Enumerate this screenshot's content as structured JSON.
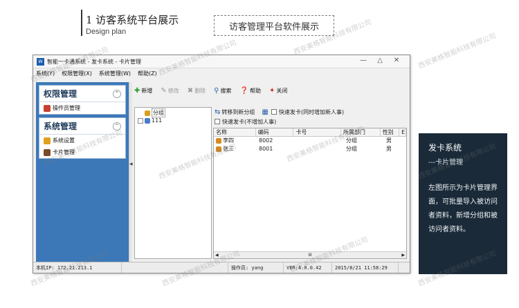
{
  "slide": {
    "title": "1  访客系统平台展示",
    "subtitle": "Design plan",
    "box_label": "访客管理平台软件展示"
  },
  "window": {
    "title": "智能一卡通系统 - 发卡系统 - 卡片管理",
    "icon_text": "W",
    "controls": [
      "—",
      "△",
      "✕"
    ]
  },
  "menu": [
    "系统(Y)",
    "权限管理(X)",
    "系统管理(W)",
    "帮助(Z)"
  ],
  "nav": {
    "groups": [
      {
        "label": "权限管理",
        "items": [
          "操作员管理"
        ]
      },
      {
        "label": "系统管理",
        "items": [
          "系统设置",
          "卡片管理"
        ]
      }
    ]
  },
  "toolbar": {
    "add": "新增",
    "edit": "修改",
    "delete": "删除",
    "search": "搜索",
    "help": "帮助",
    "close": "关闭"
  },
  "tree": {
    "root": "分组",
    "child": "111"
  },
  "ops": {
    "move_to_group": "转移到新分组",
    "quick_card_with_visitor": "快速发卡(同时增加新人事)",
    "quick_card_no_visitor": "快速发卡(不增加人事)"
  },
  "grid": {
    "columns": [
      "名称",
      "编码",
      "卡号",
      "所属部门",
      "性别",
      "E"
    ],
    "rows": [
      {
        "name": "李四",
        "code": "8002",
        "card": "",
        "dept": "分组",
        "gender": "男"
      },
      {
        "name": "张三",
        "code": "8001",
        "card": "",
        "dept": "分组",
        "gender": "男"
      }
    ],
    "scroll_thumb": "III"
  },
  "status": {
    "ip": "本机IP:  172.21.213.1",
    "operator": "操作员: yang",
    "version": "VER:4.0.0.42",
    "datetime": "2015/8/21 11:58:29"
  },
  "description": {
    "title": "发卡系统",
    "subtitle": "---卡片管理",
    "body": "左图所示为卡片管理界面，可批量导入被访问者资料，新增分组和被访问者资料。"
  },
  "watermark": "西安美格智能科技有限公司",
  "colors": {
    "nav_bg": "#3c78b8",
    "desc_bg": "#1a2a38"
  }
}
